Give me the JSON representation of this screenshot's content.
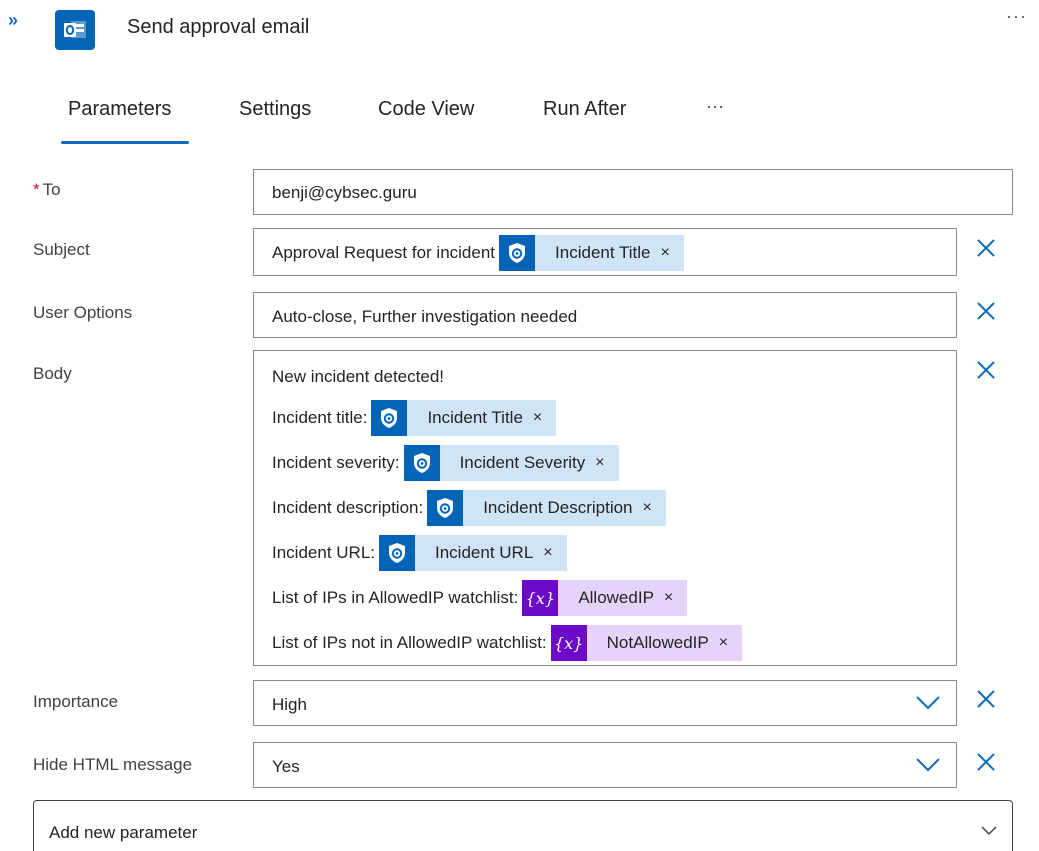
{
  "header": {
    "collapse_glyph": "»",
    "title": "Send approval email",
    "more_glyph": "···",
    "app_icon": "outlook-icon"
  },
  "tabs": [
    {
      "label": "Parameters",
      "active": true
    },
    {
      "label": "Settings",
      "active": false
    },
    {
      "label": "Code View",
      "active": false
    },
    {
      "label": "Run After",
      "active": false
    }
  ],
  "tabs_more": "···",
  "fields": {
    "to": {
      "label": "To",
      "required_mark": "*",
      "value": "benji@cybsec.guru"
    },
    "subject": {
      "label": "Subject",
      "text": "Approval Request for incident",
      "token": {
        "label": "Incident Title",
        "remove": "×",
        "icon": "sentinel-icon"
      }
    },
    "user_options": {
      "label": "User Options",
      "value": "Auto-close, Further investigation needed"
    },
    "body": {
      "label": "Body",
      "first_line": "New incident detected!",
      "lines": [
        {
          "text": "Incident title:",
          "token": "Incident Title",
          "kind": "sentinel",
          "remove": "×"
        },
        {
          "text": "Incident severity:",
          "token": "Incident Severity",
          "kind": "sentinel",
          "remove": "×"
        },
        {
          "text": "Incident description:",
          "token": "Incident Description",
          "kind": "sentinel",
          "remove": "×"
        },
        {
          "text": "Incident URL:",
          "token": "Incident URL",
          "kind": "sentinel",
          "remove": "×"
        },
        {
          "text": "List of IPs in AllowedIP watchlist:",
          "token": "AllowedIP",
          "kind": "variable",
          "remove": "×",
          "icon_text": "{x}"
        },
        {
          "text": "List of IPs not in AllowedIP watchlist:",
          "token": "NotAllowedIP",
          "kind": "variable",
          "remove": "×",
          "icon_text": "{x}"
        }
      ]
    },
    "importance": {
      "label": "Importance",
      "value": "High"
    },
    "hide_html": {
      "label": "Hide HTML message",
      "value": "Yes"
    }
  },
  "add_parameter": {
    "label": "Add new parameter"
  },
  "colors": {
    "accent": "#0f6cbd",
    "sentinel_token_bg": "#cfe4f7",
    "sentinel_icon_bg": "#0364b8",
    "variable_token_bg": "#e6d3fb",
    "variable_icon_bg": "#6b0ac9",
    "required": "#c50f1f"
  }
}
